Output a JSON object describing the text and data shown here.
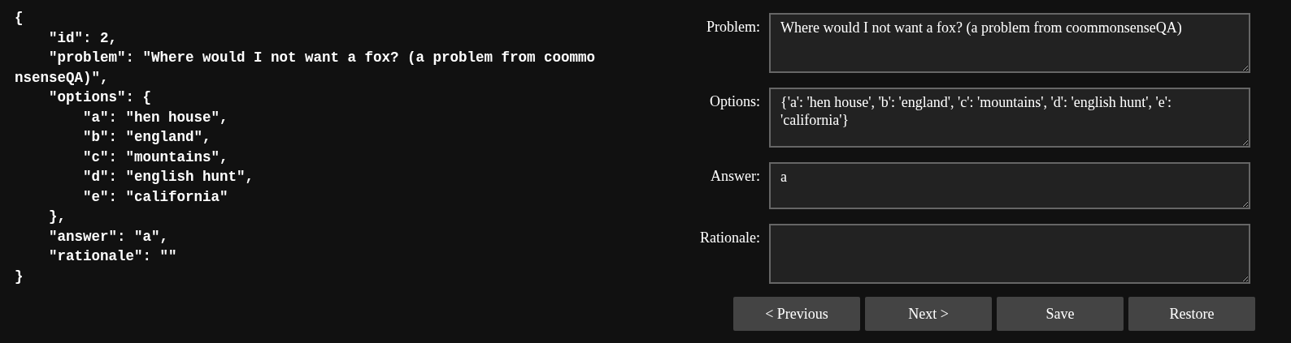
{
  "json_preview": {
    "lines": [
      "{",
      "    \"id\": 2,",
      "    \"problem\": \"Where would I not want a fox? (a problem from coommonsenseQA)\",",
      "    \"options\": {",
      "        \"a\": \"hen house\",",
      "        \"b\": \"england\",",
      "        \"c\": \"mountains\",",
      "        \"d\": \"english hunt\",",
      "        \"e\": \"california\"",
      "    },",
      "    \"answer\": \"a\",",
      "    \"rationale\": \"\"",
      "}"
    ]
  },
  "form": {
    "fields": [
      {
        "label": "Problem:",
        "value": "Where would I not want a fox? (a problem from coommonsenseQA)",
        "kind": "tall"
      },
      {
        "label": "Options:",
        "value": "{'a': 'hen house', 'b': 'england', 'c': 'mountains', 'd': 'english hunt', 'e': 'california'}",
        "kind": "tall"
      },
      {
        "label": "Answer:",
        "value": "a",
        "kind": "short"
      },
      {
        "label": "Rationale:",
        "kind": "tall"
      }
    ],
    "buttons": [
      "< Previous",
      "Next >",
      "Save",
      "Restore"
    ]
  }
}
